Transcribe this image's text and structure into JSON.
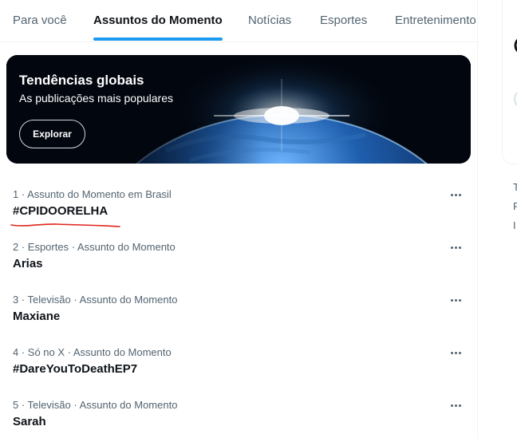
{
  "tabs": [
    "Para você",
    "Assuntos do Momento",
    "Notícias",
    "Esportes",
    "Entretenimento"
  ],
  "active_tab": "Assuntos do Momento",
  "banner": {
    "title": "Tendências globais",
    "subtitle": "As publicações mais populares",
    "button_label": "Explorar"
  },
  "trends": [
    {
      "meta": "1 · Assunto do Momento em Brasil",
      "name": "#CPIDOORELHA"
    },
    {
      "meta": "2 · Esportes · Assunto do Momento",
      "name": "Arias"
    },
    {
      "meta": "3 · Televisão · Assunto do Momento",
      "name": "Maxiane"
    },
    {
      "meta": "4 · Só no X · Assunto do Momento",
      "name": "#DareYouToDeathEP7"
    },
    {
      "meta": "5 · Televisão · Assunto do Momento",
      "name": "Sarah"
    }
  ],
  "right_column": {
    "fragments": [
      "T",
      "F",
      "I"
    ]
  },
  "colors": {
    "accent": "#1d9bf0",
    "text_primary": "#0f1419",
    "text_secondary": "#536471",
    "annotation_red": "#e0241c"
  }
}
